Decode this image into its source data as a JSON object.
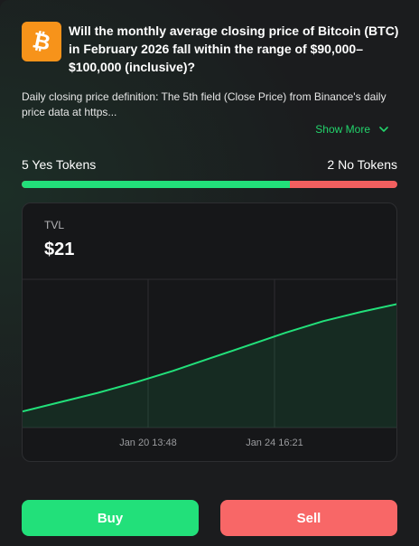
{
  "market": {
    "question": "Will the monthly average closing price of Bitcoin (BTC) in February 2026 fall within the range of $90,000–$100,000 (inclusive)?",
    "definition": "Daily closing price definition: The 5th field (Close Price) from Binance's daily price data at https...",
    "show_more_label": "Show More",
    "logo_icon": "bitcoin-icon",
    "logo_color": "#f7931a"
  },
  "tokens": {
    "yes_label": "5 Yes Tokens",
    "no_label": "2 No Tokens",
    "yes_share": 0.714,
    "yes_color": "#22e07a",
    "no_color": "#f25f5f"
  },
  "tvl": {
    "label": "TVL",
    "value": "$21"
  },
  "chart_data": {
    "type": "area",
    "x_tick_labels": [
      "Jan 20 13:48",
      "Jan 24 16:21"
    ],
    "x": [
      0,
      0.1,
      0.2,
      0.3,
      0.4,
      0.5,
      0.6,
      0.7,
      0.8,
      0.9,
      1.0
    ],
    "values": [
      0.14,
      0.22,
      0.3,
      0.39,
      0.49,
      0.6,
      0.71,
      0.82,
      0.92,
      1.0,
      1.07
    ],
    "line_color": "#22e07a",
    "grid": true
  },
  "actions": {
    "buy_label": "Buy",
    "sell_label": "Sell"
  }
}
